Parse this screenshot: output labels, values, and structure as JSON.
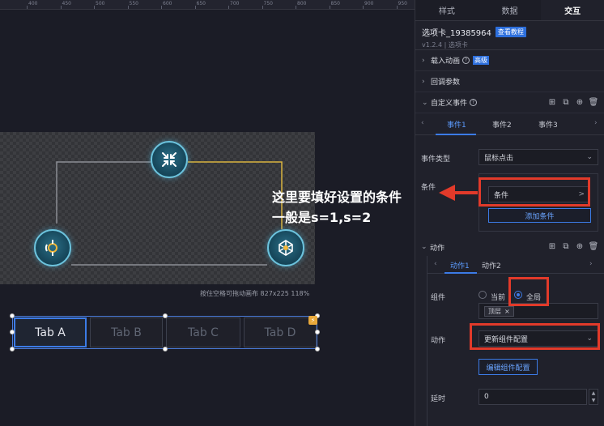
{
  "ruler": {
    "ticks": [
      "400",
      "450",
      "500",
      "550",
      "600",
      "650",
      "700",
      "750",
      "800",
      "850",
      "900",
      "950"
    ]
  },
  "canvas": {
    "hint": "按住空格可拖动画布  827x225 118%",
    "tabs": [
      "Tab A",
      "Tab B",
      "Tab C",
      "Tab D"
    ],
    "active_tab": 0
  },
  "annotation": {
    "line1": "这里要填好设置的条件",
    "line2": "一般是s=1,s=2",
    "color": "#e23a2a"
  },
  "panel": {
    "tabs": [
      "样式",
      "数据",
      "交互"
    ],
    "active_tab": 2,
    "component": {
      "title": "选项卡_19385964",
      "tutorial_label": "查看教程",
      "version": "v1.2.4 | 选项卡"
    },
    "sections": {
      "load_anim": "载入动画",
      "advanced": "高级",
      "callback": "回调参数",
      "custom_event": "自定义事件"
    },
    "event_tabs": [
      "事件1",
      "事件2",
      "事件3"
    ],
    "event": {
      "type_label": "事件类型",
      "type_value": "鼠标点击",
      "condition_label": "条件",
      "condition_value": "条件",
      "condition_arrow": ">",
      "add_condition": "添加条件"
    },
    "action_section": "动作",
    "action_tabs": [
      "动作1",
      "动作2"
    ],
    "action": {
      "component_label": "组件",
      "radio_current": "当前",
      "radio_global": "全局",
      "selected_radio": "全局",
      "tag": "顶层",
      "tag_close": "×",
      "action_label": "动作",
      "action_value": "更新组件配置",
      "edit_button": "编辑组件配置",
      "delay_label": "延时",
      "delay_value": "0"
    }
  },
  "colors": {
    "accent": "#3c7be6",
    "panel_bg": "#20212b",
    "canvas_bg": "#1b1c26"
  }
}
